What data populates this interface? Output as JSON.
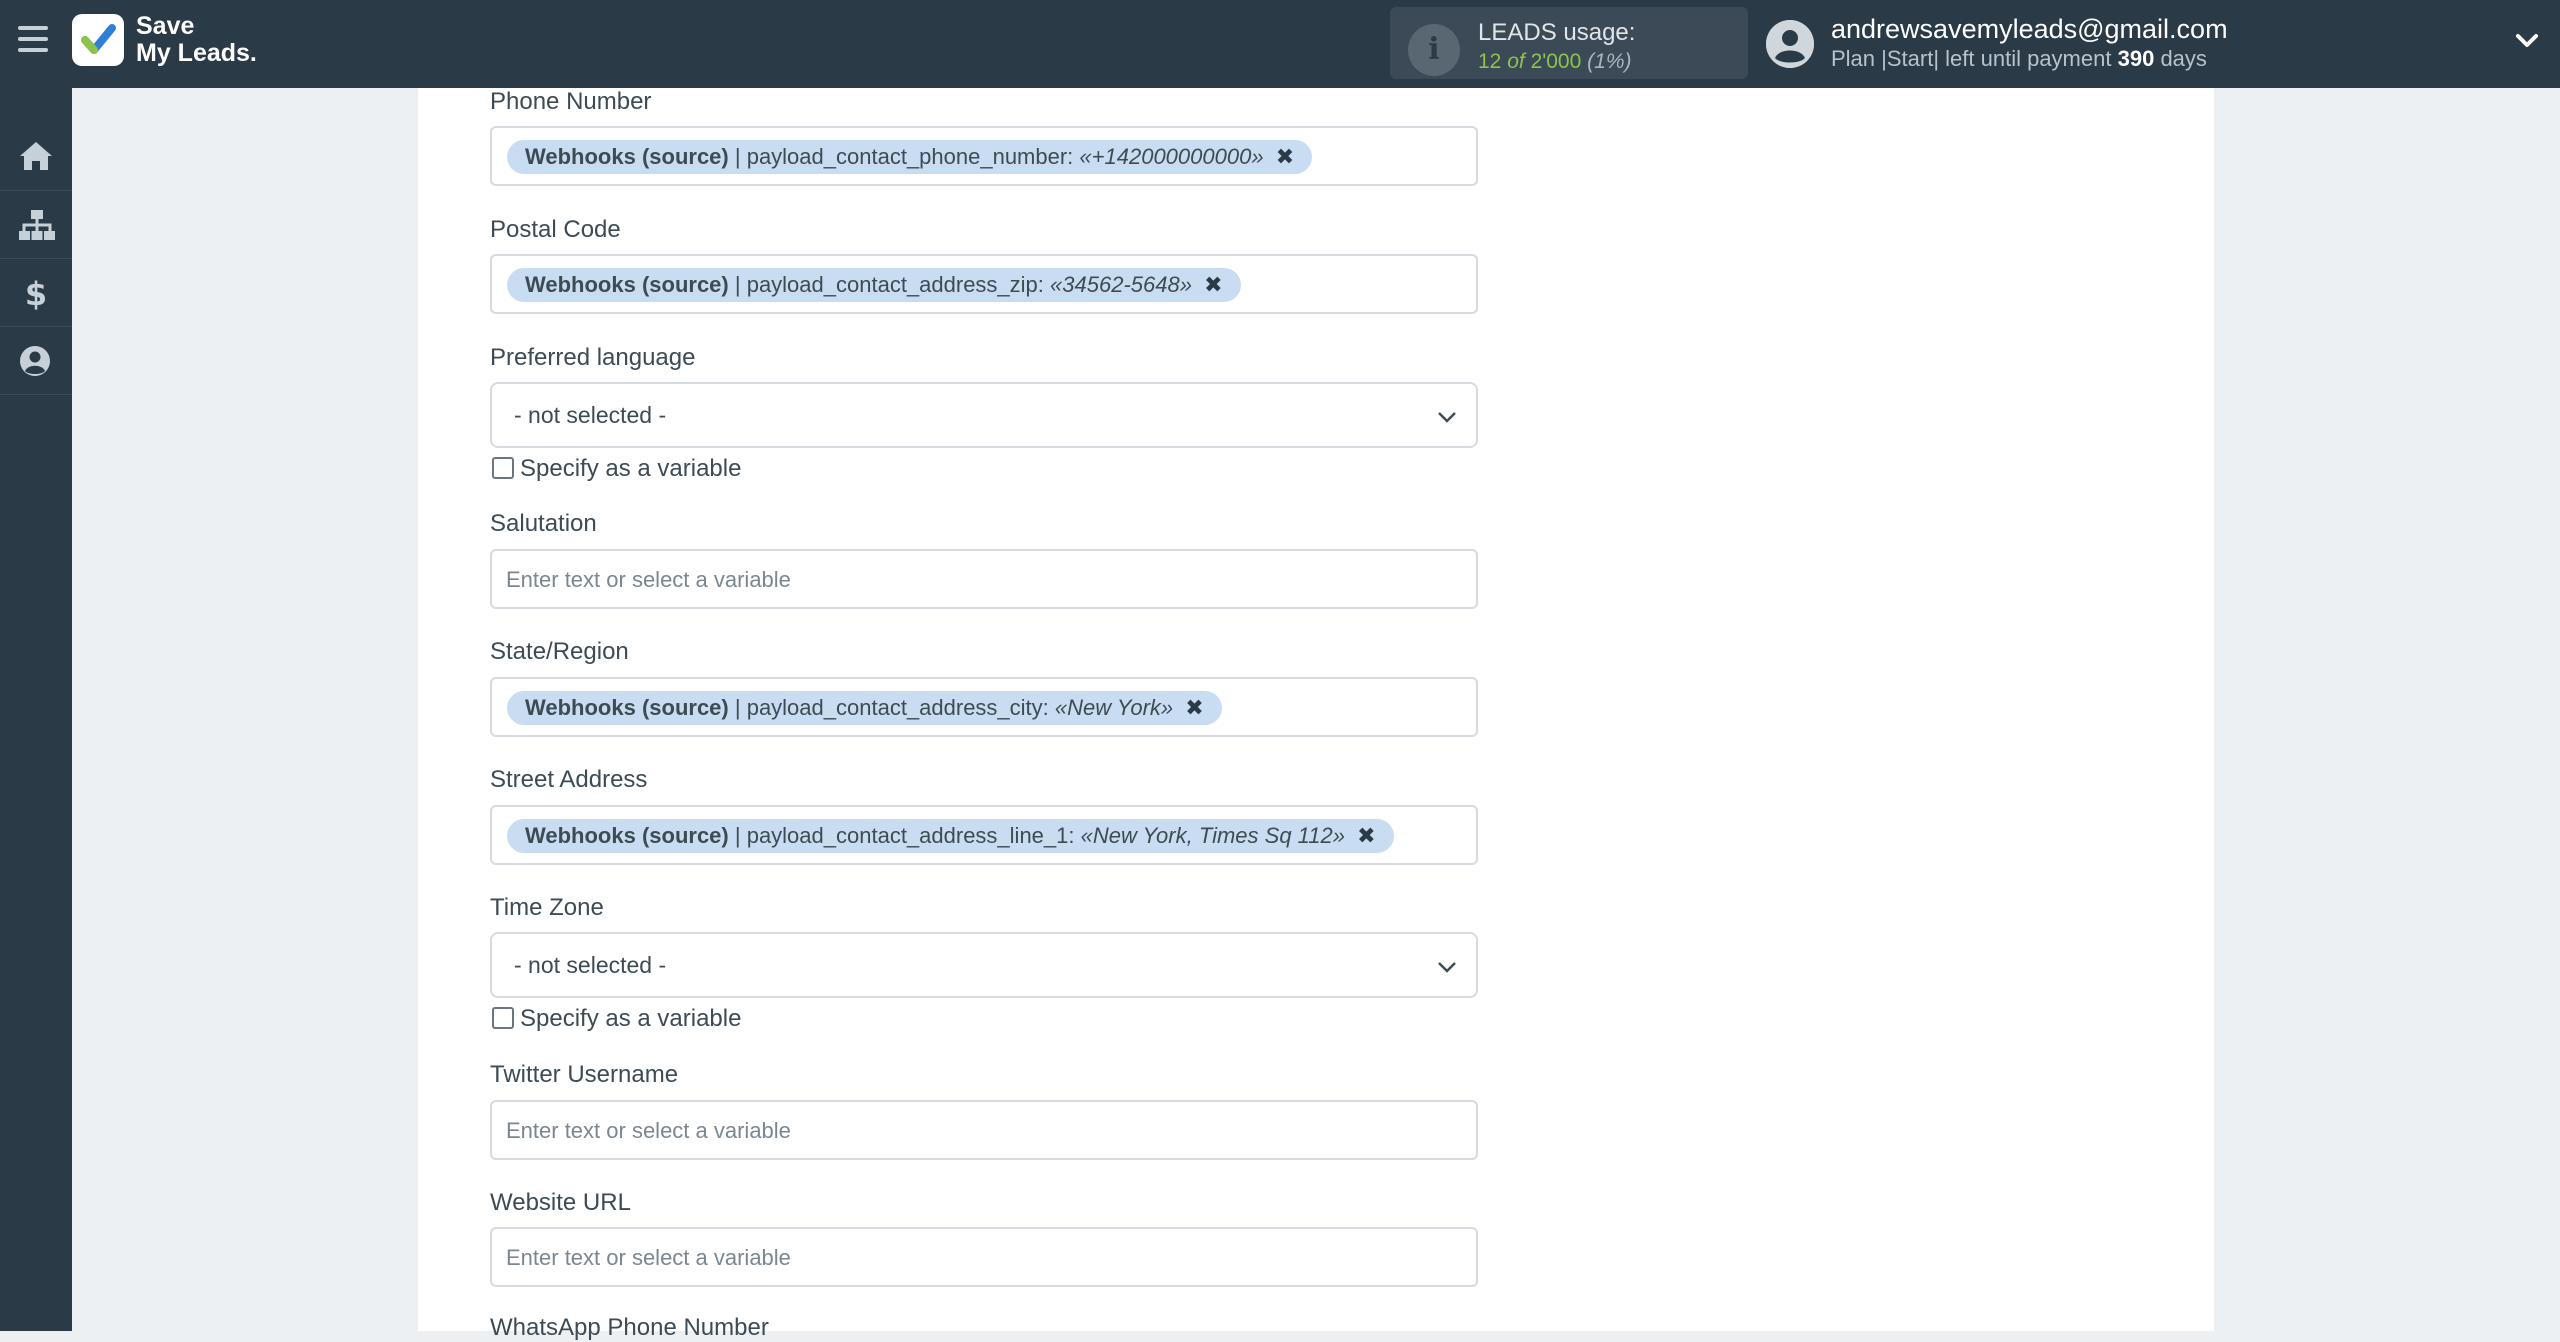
{
  "brand": {
    "line1": "Save",
    "line2": "My Leads."
  },
  "usage": {
    "label": "LEADS usage:",
    "used": "12",
    "of": "of",
    "total": "2'000",
    "percent": "(1%)"
  },
  "user": {
    "email": "andrewsavemyleads@gmail.com",
    "plan_prefix": "Plan |Start| left until payment",
    "days": "390",
    "days_suffix": "days"
  },
  "sidebar": {
    "items": [
      "home-icon",
      "sitemap-icon",
      "dollar-icon",
      "user-circle-icon"
    ]
  },
  "form": {
    "phone": {
      "label": "Phone Number",
      "chip_source": "Webhooks (source)",
      "chip_field": "| payload_contact_phone_number:",
      "chip_value": "«+142000000000»"
    },
    "postal": {
      "label": "Postal Code",
      "chip_source": "Webhooks (source)",
      "chip_field": "| payload_contact_address_zip:",
      "chip_value": "«34562-5648»"
    },
    "language": {
      "label": "Preferred language",
      "value": "- not selected -",
      "checkbox": "Specify as a variable"
    },
    "salutation": {
      "label": "Salutation",
      "placeholder": "Enter text or select a variable"
    },
    "state": {
      "label": "State/Region",
      "chip_source": "Webhooks (source)",
      "chip_field": "| payload_contact_address_city:",
      "chip_value": "«New York»"
    },
    "street": {
      "label": "Street Address",
      "chip_source": "Webhooks (source)",
      "chip_field": "| payload_contact_address_line_1:",
      "chip_value": "«New York, Times Sq 112»"
    },
    "timezone": {
      "label": "Time Zone",
      "value": "- not selected -",
      "checkbox": "Specify as a variable"
    },
    "twitter": {
      "label": "Twitter Username",
      "placeholder": "Enter text or select a variable"
    },
    "website": {
      "label": "Website URL",
      "placeholder": "Enter text or select a variable"
    },
    "whatsapp": {
      "label": "WhatsApp Phone Number"
    }
  },
  "colors": {
    "topbar": "#2b3a47",
    "chip": "#c9ddf2",
    "usage_green": "#8fc24a"
  }
}
